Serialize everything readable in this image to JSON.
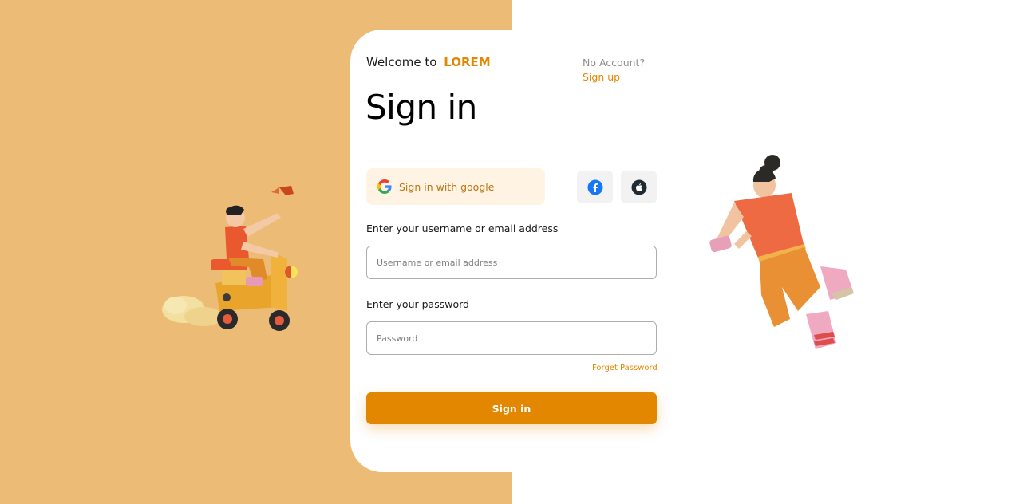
{
  "header": {
    "welcome_text": "Welcome to",
    "brand_name": "LOREM",
    "no_account_text": "No Account?",
    "signup_label": "Sign up"
  },
  "title": "Sign in",
  "social": {
    "google_label": "Sign in with google",
    "facebook_icon": "facebook-icon",
    "apple_icon": "apple-icon",
    "google_icon": "google-icon"
  },
  "form": {
    "username_label": "Enter your username or email address",
    "username_placeholder": "Username or email address",
    "password_label": "Enter your password",
    "password_placeholder": "Password",
    "forget_label": "Forget Password",
    "submit_label": "Sign in"
  },
  "colors": {
    "accent": "#E48700",
    "left_background": "#ECBB76",
    "google_button_bg": "#FFF4E3"
  },
  "illustrations": {
    "left": "scooter-rider-illustration",
    "right": "jumping-person-illustration"
  }
}
